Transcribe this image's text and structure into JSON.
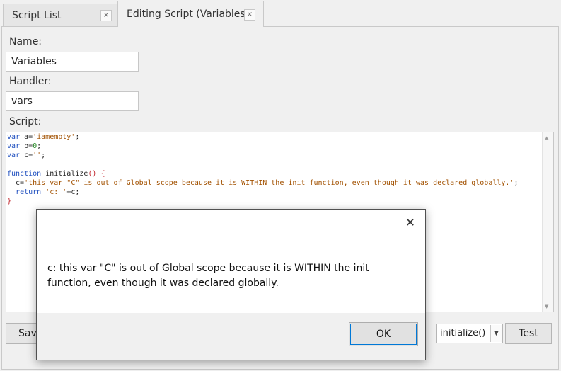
{
  "tabs": [
    {
      "label": "Script List",
      "close": "×"
    },
    {
      "label": "Editing Script (Variables)",
      "close": "×"
    }
  ],
  "form": {
    "name_label": "Name:",
    "name_value": "Variables",
    "handler_label": "Handler:",
    "handler_value": "vars",
    "script_label": "Script:"
  },
  "script": {
    "line1_kw": "var",
    "line1_rest": " a=",
    "line1_str": "'iamempty'",
    "line1_end": ";",
    "line2_kw": "var",
    "line2_rest": " b=",
    "line2_num": "0",
    "line2_end": ";",
    "line3_kw": "var",
    "line3_rest": " c=",
    "line3_str": "''",
    "line3_end": ";",
    "line5_kw": "function",
    "line5_name": " initialize",
    "line5_paren": "() {",
    "line6_pre": "  c=",
    "line6_str": "'this var \"C\" is out of Global scope because it is WITHIN the init function, even though it was declared globally.'",
    "line6_end": ";",
    "line7_pre": "  ",
    "line7_kw": "return",
    "line7_sp": " ",
    "line7_str": "'c: '",
    "line7_end": "+c;",
    "line8": "}"
  },
  "footer": {
    "save_label": "Save",
    "handler_select": "initialize()",
    "test_label": "Test"
  },
  "dialog": {
    "close": "✕",
    "message": "c: this var \"C\" is out of Global scope because it is WITHIN the init function, even though it was declared globally.",
    "ok_label": "OK"
  }
}
